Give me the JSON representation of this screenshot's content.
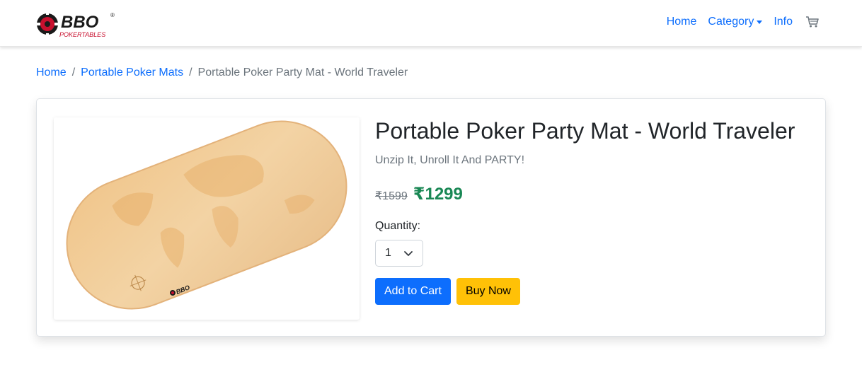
{
  "brand": {
    "logo_text": "BBO",
    "logo_subtext": "POKERTABLES",
    "logo_mark": "®"
  },
  "nav": {
    "home": "Home",
    "category": "Category",
    "info": "Info",
    "cart_icon": "cart-icon"
  },
  "breadcrumb": {
    "home": "Home",
    "category": "Portable Poker Mats",
    "current": "Portable Poker Party Mat - World Traveler",
    "separator": "/"
  },
  "product": {
    "title": "Portable Poker Party Mat - World Traveler",
    "subtitle": "Unzip It, Unroll It And PARTY!",
    "old_price": "₹1599",
    "new_price": "₹1299",
    "quantity_label": "Quantity:",
    "quantity_value": "1",
    "mat_logo_text": "BBO"
  },
  "actions": {
    "add_to_cart": "Add to Cart",
    "buy_now": "Buy Now"
  },
  "colors": {
    "link": "#0d6efd",
    "price": "#198754",
    "primary": "#0d6efd",
    "warning": "#ffc107",
    "logo_red": "#c8102e"
  }
}
